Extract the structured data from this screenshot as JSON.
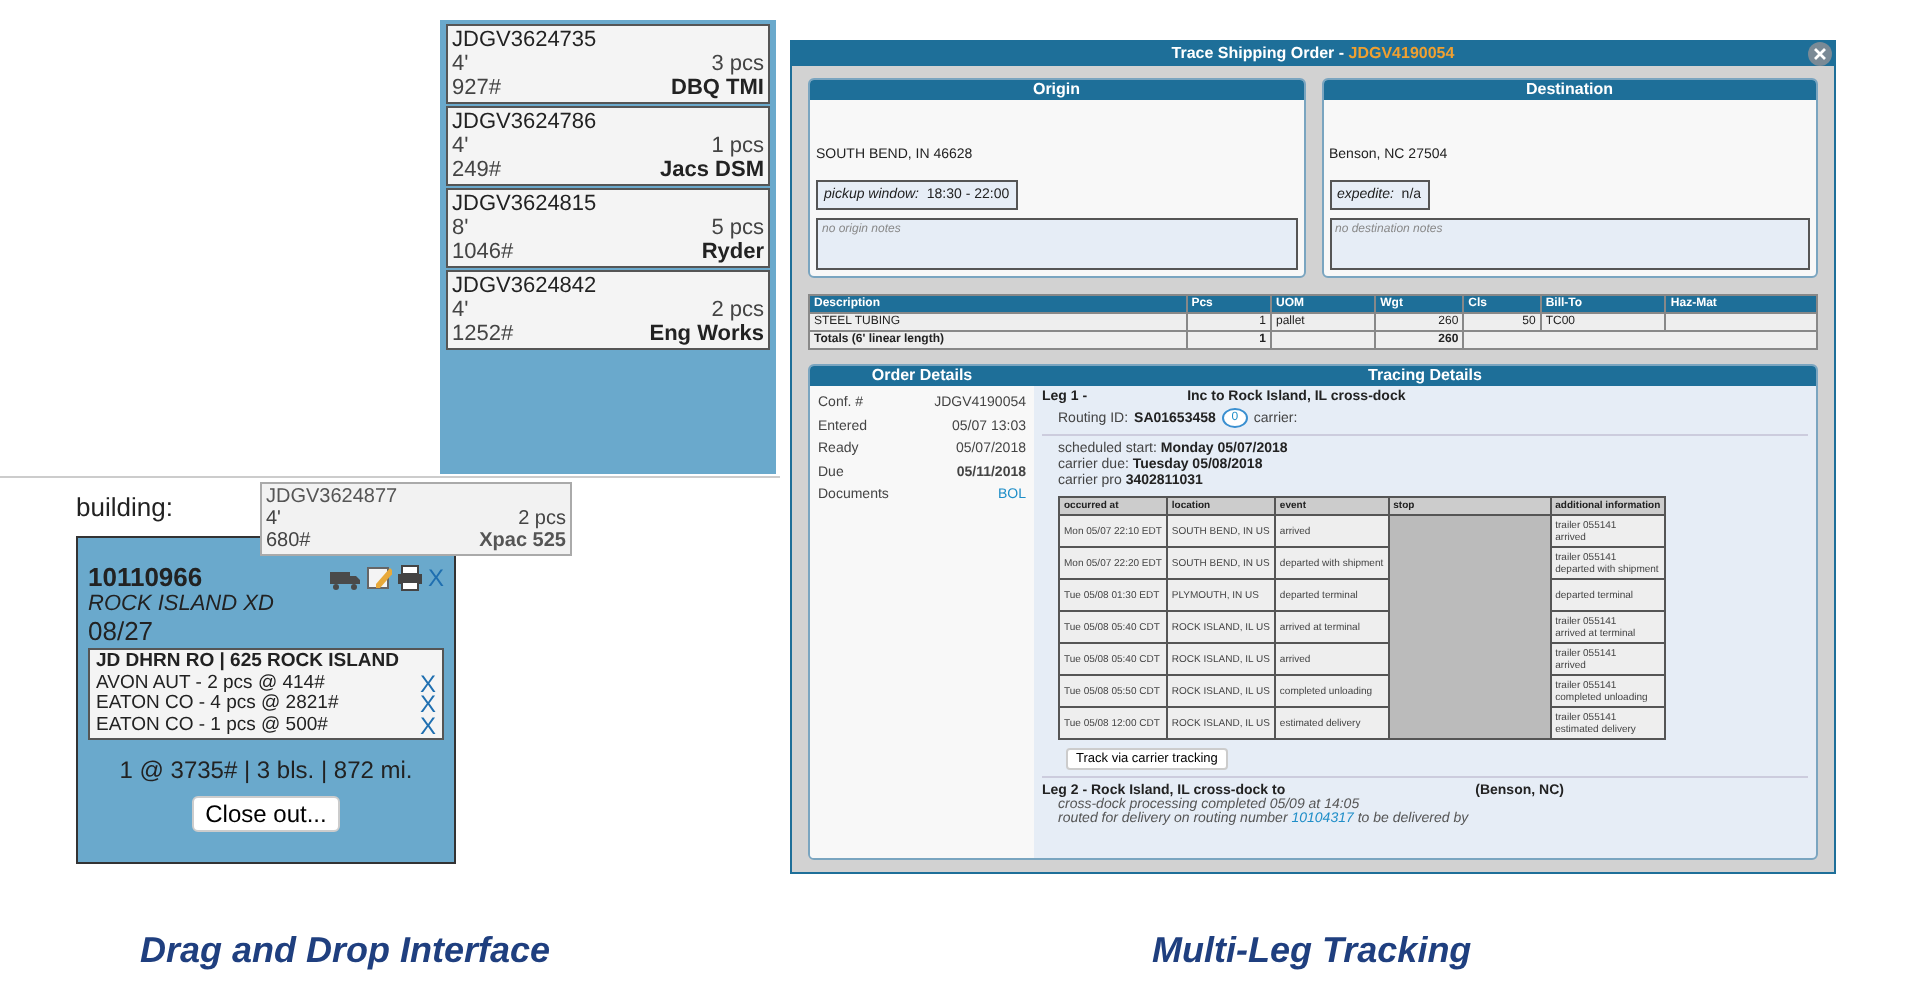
{
  "shipment_column": {
    "cards": [
      {
        "id": "JDGV3624735",
        "length": "4'",
        "pieces": "3 pcs",
        "weight": "927#",
        "carrier": "DBQ TMI"
      },
      {
        "id": "JDGV3624786",
        "length": "4'",
        "pieces": "1 pcs",
        "weight": "249#",
        "carrier": "Jacs DSM"
      },
      {
        "id": "JDGV3624815",
        "length": "8'",
        "pieces": "5 pcs",
        "weight": "1046#",
        "carrier": "Ryder"
      },
      {
        "id": "JDGV3624842",
        "length": "4'",
        "pieces": "2 pcs",
        "weight": "1252#",
        "carrier": "Eng Works"
      }
    ]
  },
  "building_label": "building:",
  "dragged_card": {
    "id": "JDGV3624877",
    "length": "4'",
    "pieces": "2 pcs",
    "weight": "680#",
    "carrier": "Xpac 525"
  },
  "load_card": {
    "number": "10110966",
    "location": "ROCK ISLAND XD",
    "date": "08/27",
    "remove": "X",
    "stop_title": "JD DHRN RO | 625 ROCK ISLAND",
    "items": [
      {
        "text": "AVON AUT - 2 pcs @ 414#",
        "remove": "X"
      },
      {
        "text": "EATON CO - 4 pcs @ 2821#",
        "remove": "X"
      },
      {
        "text": "EATON CO - 1 pcs @ 500#",
        "remove": "X"
      }
    ],
    "summary": "1 @ 3735# | 3 bls. | 872 mi.",
    "close_button": "Close out..."
  },
  "dialog": {
    "title": "Trace Shipping Order - ",
    "order_number": "JDGV4190054",
    "origin": {
      "heading": "Origin",
      "city": "SOUTH BEND, IN  46628",
      "window_label": "pickup window:",
      "window_value": "18:30 - 22:00",
      "notes_placeholder": "no origin notes"
    },
    "destination": {
      "heading": "Destination",
      "city": "Benson, NC  27504",
      "window_label": "expedite:",
      "window_value": "n/a",
      "notes_placeholder": "no destination notes"
    },
    "items_table": {
      "columns": [
        "Description",
        "Pcs",
        "UOM",
        "Wgt",
        "Cls",
        "Bill-To",
        "Haz-Mat"
      ],
      "rows": [
        [
          "STEEL TUBING",
          "1",
          "pallet",
          "260",
          "50",
          "TC00",
          ""
        ]
      ],
      "totals": {
        "label": "Totals (6' linear length)",
        "pcs": "1",
        "wgt": "260"
      }
    },
    "order_details": {
      "heading": "Order Details",
      "fields": [
        {
          "label": "Conf. #",
          "value": "JDGV4190054",
          "kind": "plain"
        },
        {
          "label": "Entered",
          "value": "05/07 13:03",
          "kind": "plain"
        },
        {
          "label": "Ready",
          "value": "05/07/2018",
          "kind": "plain"
        },
        {
          "label": "Due",
          "value": "05/11/2018",
          "kind": "bold"
        },
        {
          "label": "Documents",
          "value": "BOL",
          "kind": "link"
        }
      ]
    },
    "tracing": {
      "heading": "Tracing Details",
      "leg1": {
        "title": "Leg 1 -",
        "route": "Inc to Rock Island, IL cross-dock",
        "routing_label": "Routing ID:",
        "routing_id": "SA01653458",
        "message_count": "0",
        "carrier_label": "carrier:",
        "lines": [
          "scheduled start: **Monday 05/07/2018**",
          "carrier due: **Tuesday 05/08/2018**",
          "carrier pro **3402811031**"
        ],
        "columns": [
          "occurred at",
          "location",
          "event",
          "stop",
          "additional information"
        ],
        "events": [
          {
            "occurred": "Mon 05/07 22:10 EDT",
            "location": "SOUTH BEND, IN US",
            "event": "arrived",
            "info": [
              "trailer 055141",
              "arrived"
            ]
          },
          {
            "occurred": "Mon 05/07 22:20 EDT",
            "location": "SOUTH BEND, IN US",
            "event": "departed with shipment",
            "info": [
              "trailer 055141",
              "departed with shipment"
            ]
          },
          {
            "occurred": "Tue 05/08 01:30 EDT",
            "location": "PLYMOUTH, IN US",
            "event": "departed terminal",
            "info": [
              "departed terminal"
            ]
          },
          {
            "occurred": "Tue 05/08 05:40 CDT",
            "location": "ROCK ISLAND, IL US",
            "event": "arrived at terminal",
            "info": [
              "trailer 055141",
              "arrived at terminal"
            ]
          },
          {
            "occurred": "Tue 05/08 05:40 CDT",
            "location": "ROCK ISLAND, IL US",
            "event": "arrived",
            "info": [
              "trailer 055141",
              "arrived"
            ]
          },
          {
            "occurred": "Tue 05/08 05:50 CDT",
            "location": "ROCK ISLAND, IL US",
            "event": "completed unloading",
            "info": [
              "trailer 055141",
              "completed unloading"
            ]
          },
          {
            "occurred": "Tue 05/08 12:00 CDT",
            "location": "ROCK ISLAND, IL US",
            "event": "estimated delivery",
            "info": [
              "trailer 055141",
              "estimated delivery"
            ]
          }
        ],
        "track_button": "Track via carrier tracking"
      },
      "leg2": {
        "title": "Leg 2 - Rock Island, IL cross-dock to",
        "destination": "(Benson, NC)",
        "note": "cross-dock processing completed 05/09 at 14:05",
        "routed_text": "routed for delivery on routing number ",
        "routing_number": "10104317",
        "routed_tail": " to be delivered by"
      }
    }
  },
  "captions": [
    "Drag and Drop Interface",
    "Multi-Leg Tracking"
  ]
}
